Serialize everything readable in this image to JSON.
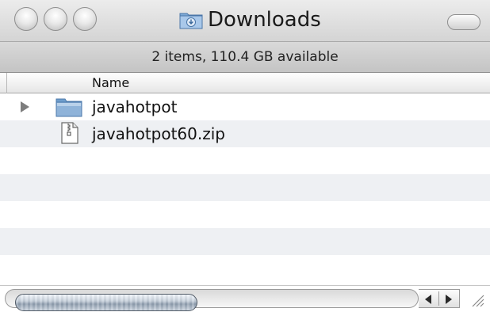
{
  "window": {
    "title": "Downloads",
    "title_icon": "downloads-folder-icon"
  },
  "statusbar": {
    "text": "2 items, 110.4 GB available"
  },
  "list": {
    "column_header": "Name",
    "items": [
      {
        "label": "javahotpot",
        "icon": "folder-icon",
        "expandable": true
      },
      {
        "label": "javahotpot60.zip",
        "icon": "zip-file-icon",
        "expandable": false
      }
    ]
  },
  "colors": {
    "alternate_row": "#eef0f3",
    "folder_blue": "#8fb3d9"
  }
}
